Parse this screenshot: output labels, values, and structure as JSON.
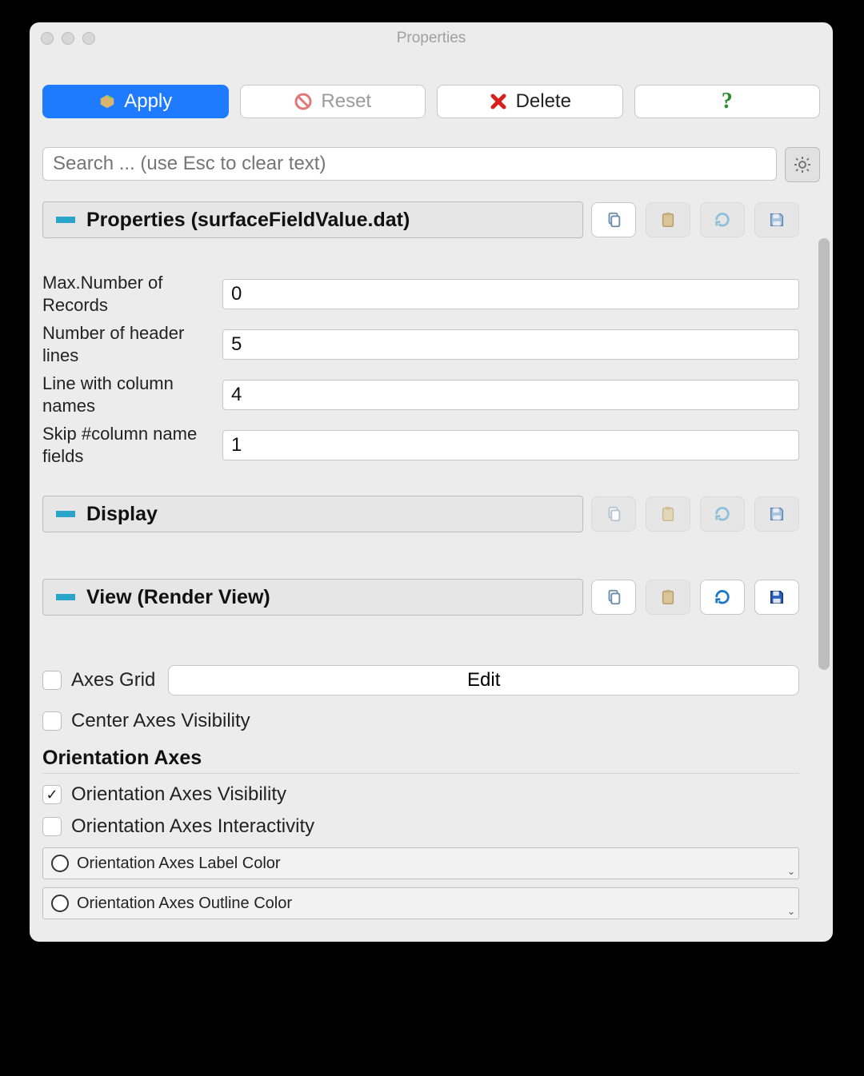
{
  "window": {
    "title": "Properties"
  },
  "toolbar": {
    "apply": "Apply",
    "reset": "Reset",
    "delete": "Delete"
  },
  "search": {
    "placeholder": "Search ... (use Esc to clear text)"
  },
  "sections": {
    "properties": {
      "title": "Properties (surfaceFieldValue.dat)"
    },
    "display": {
      "title": "Display"
    },
    "view": {
      "title": "View (Render View)"
    }
  },
  "fields": {
    "max_records": {
      "label": "Max.Number of Records",
      "value": "0"
    },
    "header_lines": {
      "label": "Number of header lines",
      "value": "5"
    },
    "column_names_line": {
      "label": "Line with column names",
      "value": "4"
    },
    "skip_column_fields": {
      "label": "Skip #column name fields",
      "value": "1"
    }
  },
  "view_panel": {
    "axes_grid_label": "Axes Grid",
    "axes_grid_edit": "Edit",
    "center_axes_visibility": "Center Axes Visibility",
    "orientation_axes_heading": "Orientation Axes",
    "orientation_axes_visibility": "Orientation Axes Visibility",
    "orientation_axes_interactivity": "Orientation Axes Interactivity",
    "orientation_axes_label_color": "Orientation Axes Label Color",
    "orientation_axes_outline_color": "Orientation Axes Outline Color"
  },
  "checks": {
    "axes_grid": false,
    "center_axes_visibility": false,
    "orientation_axes_visibility": true,
    "orientation_axes_interactivity": false
  }
}
